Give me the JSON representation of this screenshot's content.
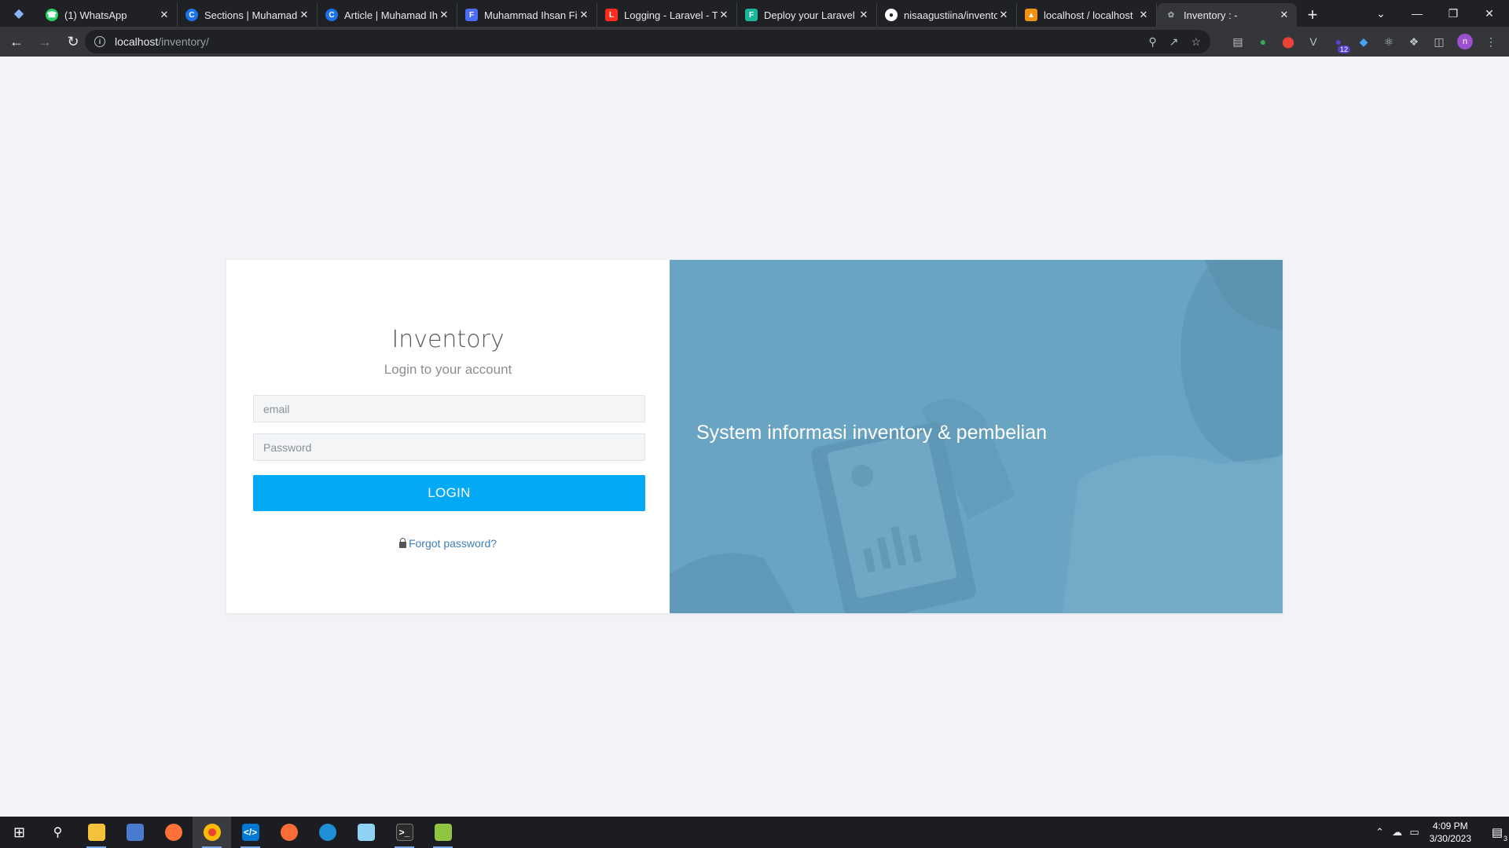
{
  "browser": {
    "tabs": [
      {
        "title": "(1) WhatsApp",
        "favicon": "whatsapp-icon",
        "color": "#25d366",
        "active": false
      },
      {
        "title": "Sections | Muhamad",
        "favicon": "dev-icon",
        "color": "#1a73e8",
        "active": false
      },
      {
        "title": "Article | Muhamad Ih",
        "favicon": "dev-icon",
        "color": "#1a73e8",
        "active": false
      },
      {
        "title": "Muhammad Ihsan Fir",
        "favicon": "f-icon",
        "color": "#4a6cf7",
        "active": false
      },
      {
        "title": "Logging - Laravel - Th",
        "favicon": "laravel-icon",
        "color": "#ff2d20",
        "active": false
      },
      {
        "title": "Deploy your Laravel P",
        "favicon": "forge-icon",
        "color": "#19b69b",
        "active": false
      },
      {
        "title": "nisaagustiina/invento",
        "favicon": "github-icon",
        "color": "#ffffff",
        "active": false
      },
      {
        "title": "localhost / localhost",
        "favicon": "phpmyadmin-icon",
        "color": "#f29111",
        "active": false
      },
      {
        "title": "Inventory : -",
        "favicon": "leaf-icon",
        "color": "#9aa0a6",
        "active": true
      }
    ],
    "url_host": "localhost",
    "url_path": "/inventory/",
    "extension_badge": "12",
    "profile_initial": "n"
  },
  "login": {
    "title": "Inventory",
    "subtitle": "Login to your account",
    "email_placeholder": "email",
    "password_placeholder": "Password",
    "button_label": "LOGIN",
    "forgot_label": "Forgot password?"
  },
  "hero": {
    "tagline": "System informasi inventory & pembelian"
  },
  "taskbar": {
    "apps": [
      "start",
      "search",
      "file-explorer",
      "network-tool",
      "firefox",
      "chrome",
      "vscode",
      "postman",
      "mysql-workbench",
      "notepad",
      "terminal",
      "notepad-plus-plus"
    ],
    "time": "4:09 PM",
    "date": "3/30/2023",
    "notification_count": "3"
  },
  "colors": {
    "accent": "#03a9f4",
    "hero_bg": "#6aa4c3",
    "link": "#3c7db8",
    "page_bg": "#f1f3f6"
  }
}
